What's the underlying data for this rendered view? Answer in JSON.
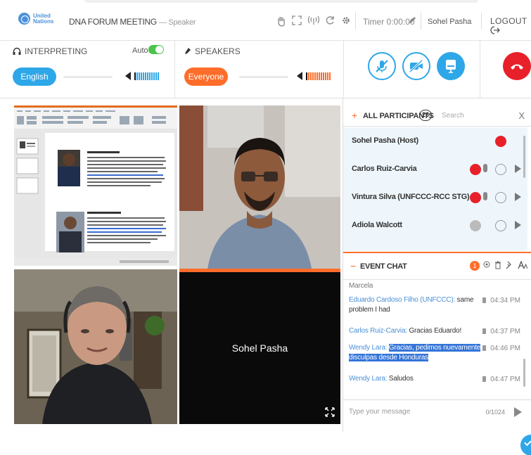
{
  "header": {
    "logo_text": "United Nations",
    "meeting_title": "DNA FORUM MEETING",
    "role": "— Speaker",
    "timer": "Timer 0:00:00",
    "user": "Sohel Pasha",
    "logout_label": "LOGOUT"
  },
  "interpreting": {
    "label": "INTERPRETING",
    "auto_label": "Auto",
    "language": "English"
  },
  "speakers": {
    "label": "SPEAKERS",
    "target": "Everyone"
  },
  "videos": {
    "black_tile_name": "Sohel Pasha"
  },
  "participants": {
    "title": "ALL PARTICIPANTS",
    "count": "26",
    "search_placeholder": "Search",
    "close": "X",
    "rows": [
      {
        "name": "Sohel Pasha (Host)"
      },
      {
        "name": "Carlos Ruiz-Carvia"
      },
      {
        "name": "Vintura Silva (UNFCCC-RCC STG)"
      },
      {
        "name": "Adiola Walcott"
      }
    ]
  },
  "chat": {
    "title": "EVENT CHAT",
    "badge": "1",
    "messages": [
      {
        "author": "",
        "text": "Marcela",
        "time": ""
      },
      {
        "author": "Eduardo Cardoso Filho (UNFCCC):",
        "text": " same problem I had",
        "time": "04:34 PM"
      },
      {
        "author": "Carlos Ruiz-Carvia:",
        "text": " Gracias Eduardo!",
        "time": "04:37 PM"
      },
      {
        "author": "Wendy Lara:",
        "text": "Gracias, pedimos nuevamente disculpas desde Honduras",
        "time": "04:46 PM"
      },
      {
        "author": "Wendy Lara:",
        "text": " Saludos",
        "time": "04:47 PM"
      }
    ],
    "input_placeholder": "Type your message",
    "char_count": "0/1024"
  },
  "colors": {
    "accent_blue": "#2ea7e8",
    "accent_orange": "#ff6d2a",
    "hangup_red": "#e8202a"
  }
}
